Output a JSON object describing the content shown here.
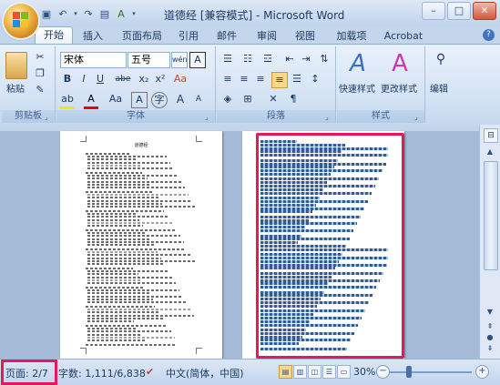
{
  "window": {
    "title": "道德经 [兼容模式] - Microsoft Word",
    "controls": [
      "–",
      "□",
      "✕"
    ]
  },
  "qat": {
    "icons": [
      "save-icon",
      "undo-icon",
      "redo-icon",
      "print-preview-icon",
      "spell-check-icon",
      "customize-icon"
    ]
  },
  "tabs": [
    "开始",
    "插入",
    "页面布局",
    "引用",
    "邮件",
    "审阅",
    "视图",
    "加载项",
    "Acrobat"
  ],
  "ribbon": {
    "clipboard": {
      "paste": "粘贴",
      "label": "剪贴板"
    },
    "font": {
      "font_name": "宋体",
      "font_size": "五号",
      "wen": "wén",
      "a_box": "A",
      "bold": "B",
      "italic": "I",
      "underline": "U",
      "strike": "abe",
      "sub": "x₂",
      "sup": "x²",
      "clear": "Aa",
      "color_a": "A",
      "aa_case": "Aa",
      "grow": "A",
      "shrink": "A",
      "label": "字体"
    },
    "paragraph": {
      "label": "段落"
    },
    "styles": {
      "quick": "快速样式",
      "change": "更改样式",
      "label": "样式"
    },
    "edit": {
      "label": "编辑"
    }
  },
  "left_page": {
    "title": "道德经"
  },
  "status": {
    "page": "页面: 2/7",
    "words": "字数: 1,111/6,838",
    "lang": "中文(简体，中国)",
    "zoom": "30%",
    "zoom_level": 0.3
  },
  "colors": {
    "highlight": "#e5195a",
    "selection": "#9fc0ea",
    "ribbon_bg": "#dbe7f5"
  }
}
